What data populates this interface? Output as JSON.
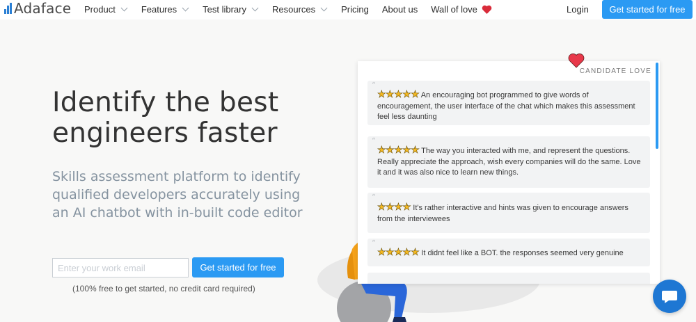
{
  "brand": {
    "name": "Adaface",
    "accent": "#2b9af3"
  },
  "nav": {
    "items": [
      {
        "label": "Product",
        "dropdown": true
      },
      {
        "label": "Features",
        "dropdown": true
      },
      {
        "label": "Test library",
        "dropdown": true
      },
      {
        "label": "Resources",
        "dropdown": true
      },
      {
        "label": "Pricing",
        "dropdown": false
      },
      {
        "label": "About us",
        "dropdown": false
      },
      {
        "label": "Wall of love",
        "dropdown": false
      }
    ],
    "login": "Login",
    "cta": "Get started for free"
  },
  "hero": {
    "headline": "Identify the best engineers faster",
    "subtitle": "Skills assessment platform to identify qualified developers accurately using an AI chatbot with in-built code editor",
    "email_placeholder": "Enter your work email",
    "cta": "Get started for free",
    "fineprint": "(100% free to get started, no credit card required)"
  },
  "testimonials": {
    "title": "CANDIDATE LOVE",
    "reviews": [
      {
        "stars": 5,
        "text": "An encouraging bot programmed to give words of encouragement, the user interface of the chat which makes this assessment feel less daunting"
      },
      {
        "stars": 5,
        "text": "The way you interacted with me, and represent the questions. Really appreciate the approach, wish every companies will do the same. Love it and it was also nice to learn new things."
      },
      {
        "stars": 4,
        "text": "It's rather interactive and hints was given to encourage answers from the interviewees"
      },
      {
        "stars": 5,
        "text": "It didnt feel like a BOT. the responses seemed very genuine"
      }
    ]
  },
  "icons": {
    "heart": "heart-icon",
    "chat": "chat-icon",
    "chevron": "chevron-down-icon",
    "star": "star-icon"
  }
}
